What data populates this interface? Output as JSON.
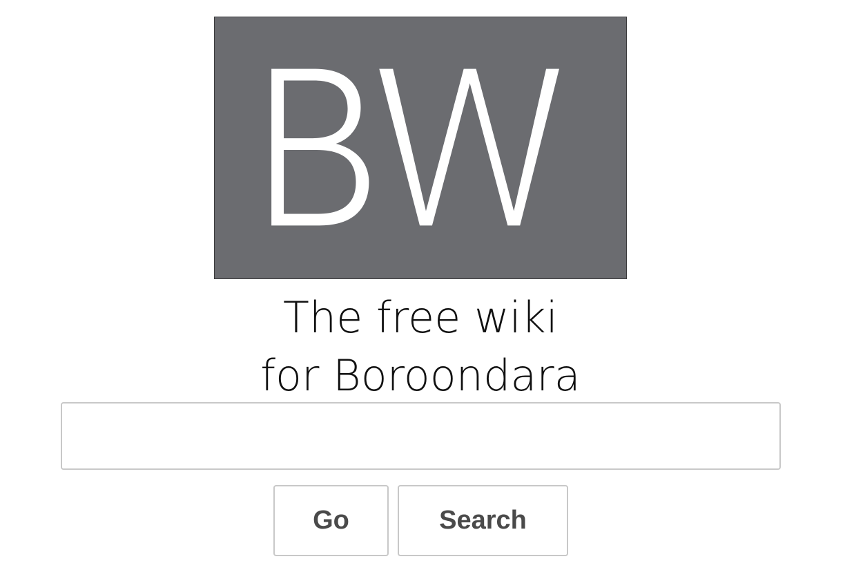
{
  "logo": {
    "text": "BW",
    "background_color": "#6b6c70",
    "text_color": "#ffffff"
  },
  "tagline": {
    "line1": "The free wiki",
    "line2": "for Boroondara"
  },
  "search": {
    "value": "",
    "placeholder": ""
  },
  "buttons": {
    "go_label": "Go",
    "search_label": "Search"
  }
}
